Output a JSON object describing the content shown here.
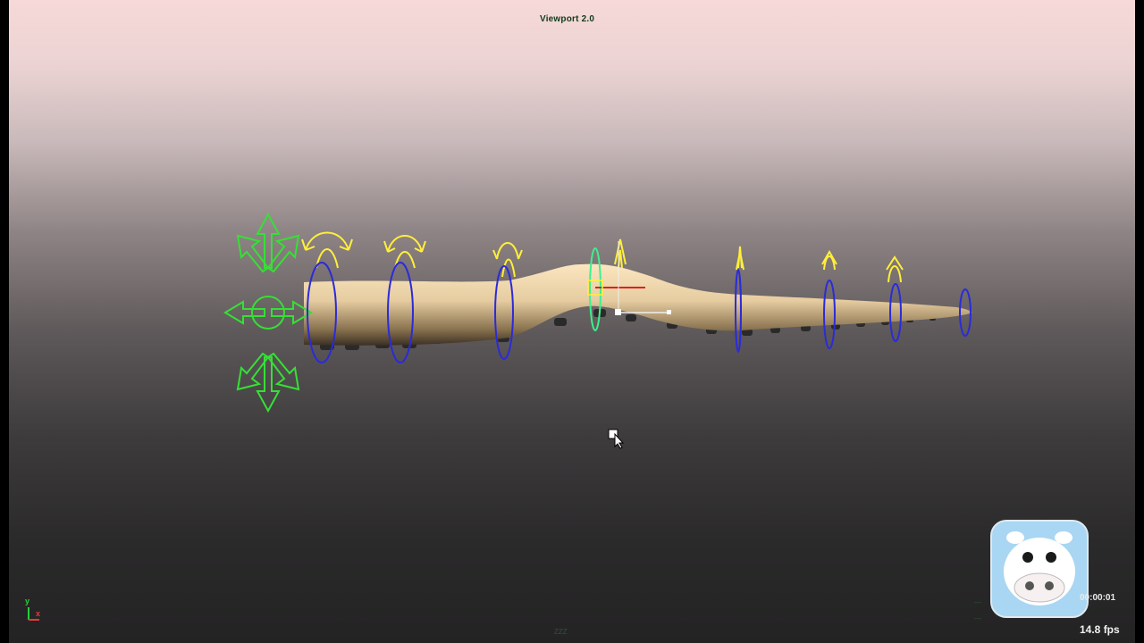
{
  "viewport": {
    "title": "Viewport 2.0",
    "background_top": "#f6d9d8",
    "background_bottom": "#242324"
  },
  "hud": {
    "frame_counter": "00:00:01",
    "fps": "14.8 fps",
    "status_text": "ZZZ",
    "axis_y": "y",
    "axis_x": "x"
  },
  "colors": {
    "mesh": "#e8cfa4",
    "mesh_shadow": "#4a3a2a",
    "master_control": "#35e035",
    "fk_arrows": "#ffef3a",
    "ik_rings": "#2b2bd8",
    "selected_ring": "#3ef08f",
    "manip_x": "#e02020"
  },
  "icons": {
    "cursor": "mouse-pointer-icon",
    "mascot": "cow-logo-icon",
    "master": "compass-arrows-icon"
  }
}
